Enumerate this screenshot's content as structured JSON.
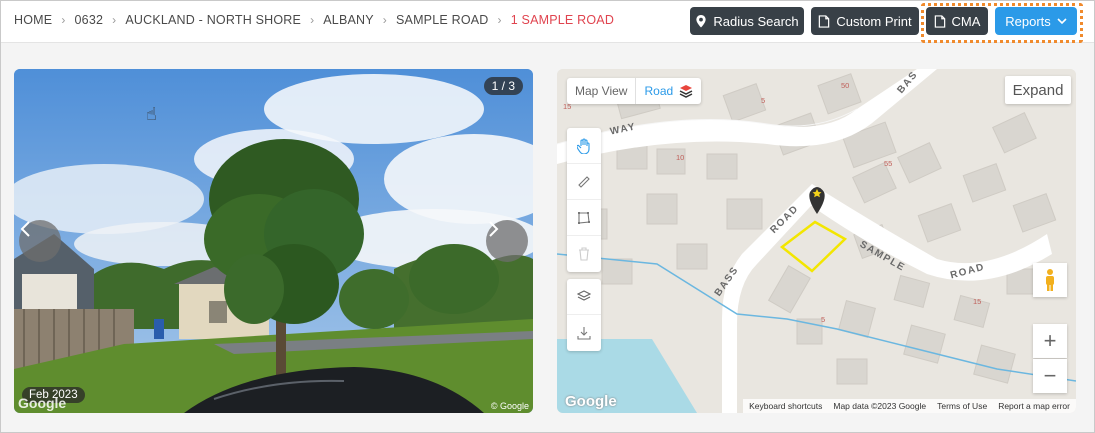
{
  "breadcrumb": [
    "HOME",
    "0632",
    "AUCKLAND - NORTH SHORE",
    "ALBANY",
    "SAMPLE ROAD",
    "1 SAMPLE ROAD"
  ],
  "toolbar": {
    "radius_search": "Radius Search",
    "custom_print": "Custom Print",
    "cma": "CMA",
    "reports": "Reports"
  },
  "photo": {
    "counter": "1 / 3",
    "date": "Feb 2023",
    "watermark_left": "Google",
    "watermark_right": "© Google"
  },
  "map": {
    "view_label": "Map View",
    "road_label": "Road",
    "expand": "Expand",
    "google_logo": "Google",
    "roads": [
      "WAY",
      "BASS",
      "ROAD",
      "SAMPLE",
      "ROAD",
      "BAS"
    ],
    "numbers": [
      "15",
      "5",
      "50",
      "10",
      "55",
      "15",
      "5"
    ],
    "attribution": [
      "Keyboard shortcuts",
      "Map data ©2023 Google",
      "Terms of Use",
      "Report a map error"
    ],
    "zoom_in": "+",
    "zoom_out": "−"
  },
  "colors": {
    "breadcrumb_current": "#e0444f",
    "button_dark": "#384047",
    "button_blue": "#2b9ae8",
    "highlight_border": "#f08a2c",
    "parcel_outline": "#f3e600"
  }
}
